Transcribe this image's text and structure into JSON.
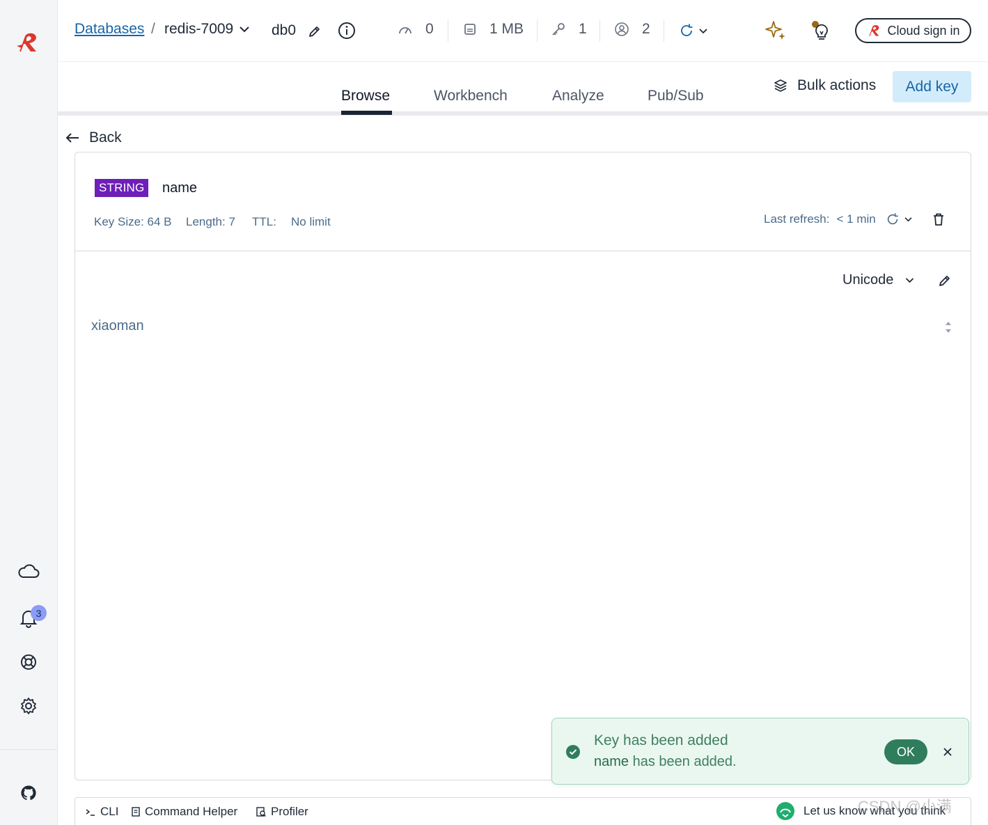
{
  "header": {
    "breadcrumb_link": "Databases",
    "breadcrumb_sep": "/",
    "database_name": "redis-7009",
    "db_index": "db0",
    "stats": {
      "ops": "0",
      "memory": "1 MB",
      "keys": "1",
      "clients": "2"
    },
    "cloud_sign_in": "Cloud sign in"
  },
  "tabs": {
    "items": [
      "Browse",
      "Workbench",
      "Analyze",
      "Pub/Sub"
    ],
    "active": "Browse",
    "bulk_actions": "Bulk actions",
    "add_key": "Add key"
  },
  "nav": {
    "back": "Back"
  },
  "key": {
    "type": "STRING",
    "name": "name",
    "size": "Key Size: 64 B",
    "length": "Length: 7",
    "ttl_label": "TTL:",
    "ttl_value": "No limit",
    "last_refresh_label": "Last refresh:",
    "last_refresh_value": "< 1 min",
    "format": "Unicode",
    "value": "xiaoman"
  },
  "toast": {
    "title": "Key has been added",
    "key_name": "name",
    "message": " has been added.",
    "ok": "OK"
  },
  "sidebar": {
    "notification_count": "3"
  },
  "bottom": {
    "cli": "CLI",
    "command_helper": "Command Helper",
    "profiler": "Profiler",
    "feedback": "Let us know what you think"
  },
  "watermark": "CSDN @小满",
  "colors": {
    "brand": "#dc382d",
    "link": "#1565a8",
    "string_badge": "#6d1fb8",
    "success": "#2f7d5d",
    "add_key_bg": "#d3ecfb"
  }
}
